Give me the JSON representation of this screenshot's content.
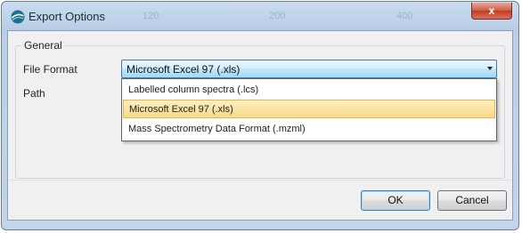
{
  "window": {
    "title": "Export Options",
    "close_label": "x",
    "ghost_columns": [
      "120",
      "200",
      "400"
    ]
  },
  "general": {
    "legend": "General",
    "file_format_label": "File Format",
    "path_label": "Path"
  },
  "file_format": {
    "selected": "Microsoft Excel 97 (.xls)",
    "options": [
      "Labelled column spectra (.lcs)",
      "Microsoft Excel 97 (.xls)",
      "Mass Spectrometry Data Format (.mzml)"
    ],
    "highlighted_index": 1
  },
  "buttons": {
    "ok": "OK",
    "cancel": "Cancel"
  }
}
